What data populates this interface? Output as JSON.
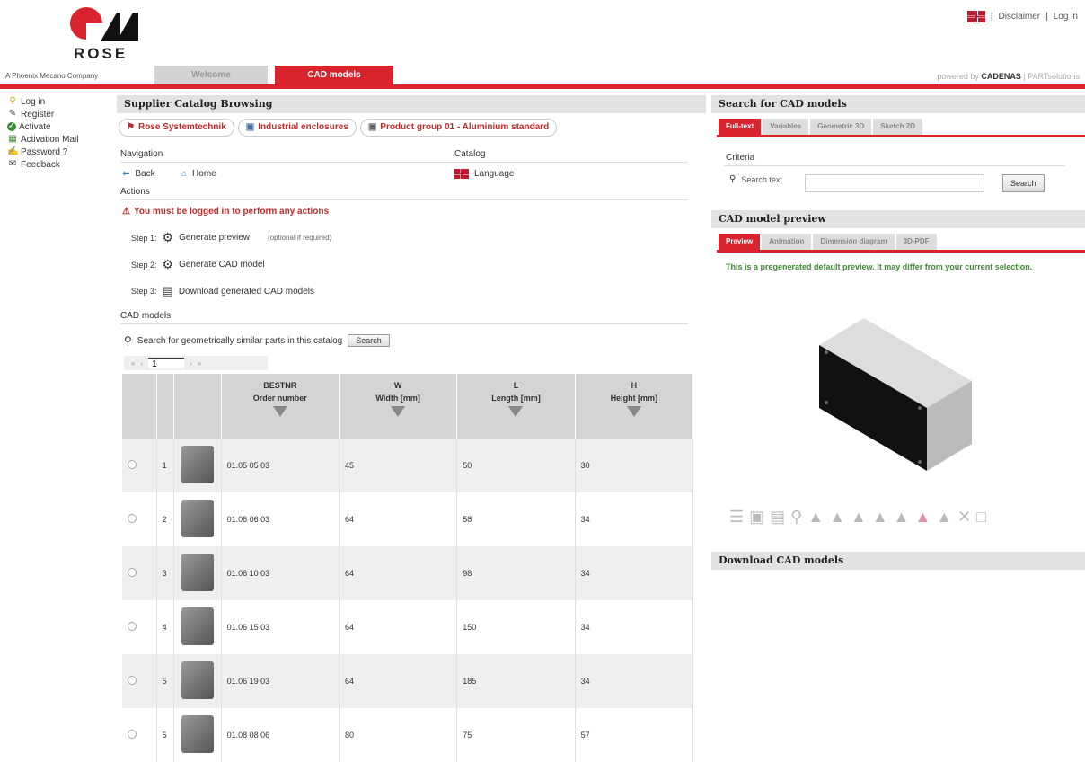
{
  "header": {
    "logo_text": "ROSE",
    "company": "A Phoenix Mecano Company",
    "tabs": [
      {
        "label": "Welcome"
      },
      {
        "label": "CAD models"
      }
    ],
    "disclaimer": "Disclaimer",
    "login": "Log in",
    "sep": "|",
    "powered_by": "powered by",
    "cadenas": "CADENAS",
    "partsolutions": "PARTsolutions"
  },
  "leftmenu": [
    {
      "label": "Log in",
      "icon": "key-icon"
    },
    {
      "label": "Register",
      "icon": "pencil-icon"
    },
    {
      "label": "Activate",
      "icon": "check-circle-icon"
    },
    {
      "label": "Activation Mail",
      "icon": "mail-grid-icon"
    },
    {
      "label": "Password ?",
      "icon": "password-icon"
    },
    {
      "label": "Feedback",
      "icon": "envelope-icon"
    }
  ],
  "center": {
    "title": "Supplier Catalog Browsing",
    "breadcrumb": [
      "Rose Systemtechnik",
      "Industrial enclosures",
      "Product group 01 - Aluminium standard"
    ],
    "navigation_label": "Navigation",
    "catalog_label": "Catalog",
    "back": "Back",
    "home": "Home",
    "language": "Language",
    "actions_label": "Actions",
    "warning": "You must be logged in to perform any actions",
    "steps": [
      {
        "num": "Step 1:",
        "label": "Generate preview",
        "note": "(optional if required)"
      },
      {
        "num": "Step 2:",
        "label": "Generate CAD model",
        "note": ""
      },
      {
        "num": "Step 3:",
        "label": "Download generated CAD models",
        "note": ""
      }
    ],
    "cad_models_label": "CAD models",
    "similar_search": "Search for geometrically similar parts in this catalog",
    "search_button": "Search",
    "pager": {
      "page": "1"
    },
    "table": {
      "headers": [
        {
          "code": "BESTNR",
          "label": "Order number"
        },
        {
          "code": "W",
          "label": "Width [mm]"
        },
        {
          "code": "L",
          "label": "Length [mm]"
        },
        {
          "code": "H",
          "label": "Height [mm]"
        }
      ],
      "rows": [
        {
          "n": "1",
          "order": "01.05 05 03",
          "w": "45",
          "l": "50",
          "h": "30"
        },
        {
          "n": "2",
          "order": "01.06 06 03",
          "w": "64",
          "l": "58",
          "h": "34"
        },
        {
          "n": "3",
          "order": "01.06 10 03",
          "w": "64",
          "l": "98",
          "h": "34"
        },
        {
          "n": "4",
          "order": "01.06 15 03",
          "w": "64",
          "l": "150",
          "h": "34"
        },
        {
          "n": "5",
          "order": "01.06 19 03",
          "w": "64",
          "l": "185",
          "h": "34"
        },
        {
          "n": "5",
          "order": "01.08 08 06",
          "w": "80",
          "l": "75",
          "h": "57"
        }
      ]
    }
  },
  "right": {
    "search_title": "Search for CAD models",
    "search_tabs": [
      "Full-text",
      "Variables",
      "Geometric 3D",
      "Sketch 2D"
    ],
    "criteria": "Criteria",
    "search_text_label": "Search text",
    "search_button": "Search",
    "preview_title": "CAD model preview",
    "preview_tabs": [
      "Preview",
      "Animation",
      "Dimension diagram",
      "3D-PDF"
    ],
    "preview_note": "This is a pregenerated default preview. It may differ from your current selection.",
    "download_title": "Download CAD models"
  },
  "colors": {
    "accent": "#d9232d",
    "warning": "#c62828",
    "note": "#3a8a2f"
  }
}
